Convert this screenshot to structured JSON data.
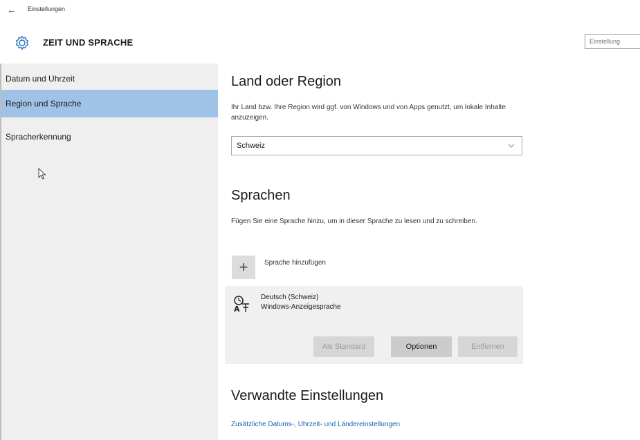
{
  "window": {
    "title": "Einstellungen",
    "back_icon": "back-arrow-icon"
  },
  "header": {
    "section_title": "ZEIT UND SPRACHE",
    "icon": "gear-icon",
    "search_placeholder": "Einstellung"
  },
  "sidebar": {
    "items": [
      {
        "label": "Datum und Uhrzeit",
        "active": false
      },
      {
        "label": "Region und Sprache",
        "active": true
      },
      {
        "label": "Spracherkennung",
        "active": false
      }
    ]
  },
  "region": {
    "heading": "Land oder Region",
    "description": "Ihr Land bzw. Ihre Region wird ggf. von Windows und von Apps genutzt, um lokale Inhalte anzuzeigen.",
    "selected": "Schweiz"
  },
  "languages": {
    "heading": "Sprachen",
    "description": "Fügen Sie eine Sprache hinzu, um in dieser Sprache zu lesen und zu schreiben.",
    "add_label": "Sprache hinzufügen",
    "items": [
      {
        "name": "Deutsch (Schweiz)",
        "subtitle": "Windows-Anzeigesprache",
        "buttons": {
          "default": "Als Standard",
          "options": "Optionen",
          "remove": "Entfernen"
        }
      }
    ]
  },
  "related": {
    "heading": "Verwandte Einstellungen",
    "link": "Zusätzliche Datums-, Uhrzeit- und Ländereinstellungen"
  },
  "colors": {
    "accent": "#9ec3e6",
    "link": "#1464b4",
    "sidebar_bg": "#efefef"
  }
}
